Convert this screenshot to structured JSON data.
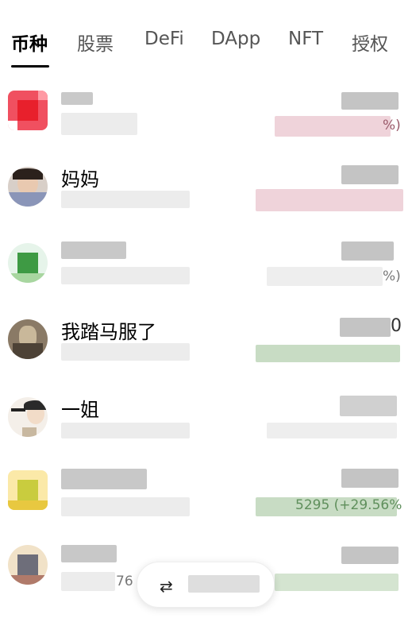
{
  "tabs": [
    {
      "label": "币种",
      "active": true
    },
    {
      "label": "股票",
      "active": false
    },
    {
      "label": "DeFi",
      "active": false
    },
    {
      "label": "DApp",
      "active": false
    },
    {
      "label": "NFT",
      "active": false
    },
    {
      "label": "授权",
      "active": false
    }
  ],
  "rows": [
    {
      "title": "",
      "avatar": "red-pixel-avatar",
      "change_snippet": "%)"
    },
    {
      "title": "妈妈",
      "avatar": "woman-portrait-avatar",
      "change_snippet": ""
    },
    {
      "title": "",
      "avatar": "green-pixel-avatar",
      "change_snippet": "%)"
    },
    {
      "title": "我踏马服了",
      "avatar": "dragon-figure-avatar",
      "change_snippet": "0"
    },
    {
      "title": "一姐",
      "avatar": "cartoon-girl-avatar",
      "change_snippet": ""
    },
    {
      "title": "",
      "avatar": "yellow-pixel-avatar",
      "change_snippet": "5295 (+29.56%"
    },
    {
      "title": "",
      "avatar": "mixed-pixel-avatar",
      "change_snippet": "76"
    }
  ],
  "floating_button": {
    "icon": "manage-icon",
    "label": "币种管理"
  },
  "colors": {
    "accent": "#000000",
    "positive": "#c8dcc4",
    "negative": "#efd3da"
  }
}
